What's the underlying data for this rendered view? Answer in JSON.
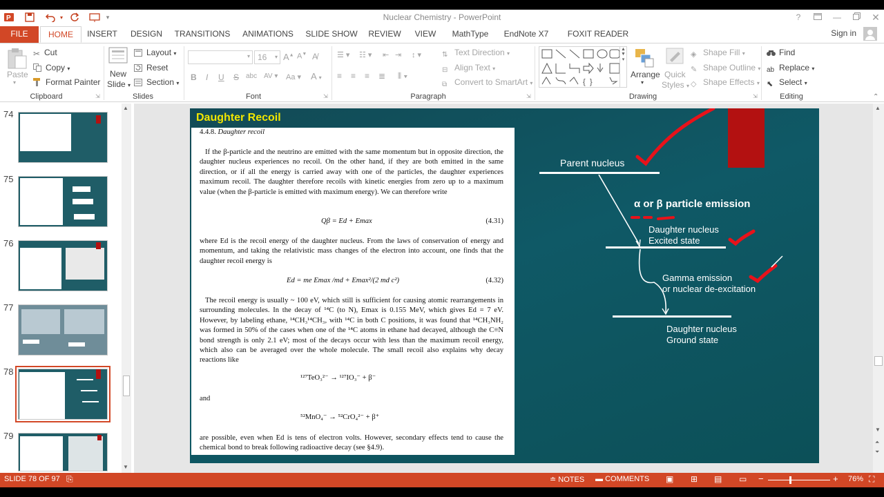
{
  "window": {
    "title": "Nuclear Chemistry - PowerPoint"
  },
  "tabs": [
    {
      "label": "FILE"
    },
    {
      "label": "HOME"
    },
    {
      "label": "INSERT"
    },
    {
      "label": "DESIGN"
    },
    {
      "label": "TRANSITIONS"
    },
    {
      "label": "ANIMATIONS"
    },
    {
      "label": "SLIDE SHOW"
    },
    {
      "label": "REVIEW"
    },
    {
      "label": "VIEW"
    },
    {
      "label": "MathType"
    },
    {
      "label": "EndNote X7"
    },
    {
      "label": "FOXIT READER PDF"
    }
  ],
  "signin": "Sign in",
  "ribbon": {
    "clipboard": {
      "paste": "Paste",
      "cut": "Cut",
      "copy": "Copy",
      "format_painter": "Format Painter",
      "label": "Clipboard"
    },
    "slides": {
      "new_slide_1": "New",
      "new_slide_2": "Slide",
      "layout": "Layout",
      "reset": "Reset",
      "section": "Section",
      "label": "Slides"
    },
    "font": {
      "size": "16",
      "label": "Font"
    },
    "paragraph": {
      "text_direction": "Text Direction",
      "align_text": "Align Text",
      "smartart": "Convert to SmartArt",
      "label": "Paragraph"
    },
    "drawing": {
      "arrange": "Arrange",
      "quick_styles_1": "Quick",
      "quick_styles_2": "Styles",
      "shape_fill": "Shape Fill",
      "shape_outline": "Shape Outline",
      "shape_effects": "Shape Effects",
      "label": "Drawing"
    },
    "editing": {
      "find": "Find",
      "replace": "Replace",
      "select": "Select",
      "label": "Editing"
    }
  },
  "thumbnails": [
    {
      "num": "74"
    },
    {
      "num": "75"
    },
    {
      "num": "76"
    },
    {
      "num": "77"
    },
    {
      "num": "78"
    },
    {
      "num": "79"
    }
  ],
  "slide": {
    "title": "Daughter Recoil",
    "doc": {
      "heading_num": "4.4.8.",
      "heading": "Daughter recoil",
      "p1": "If the β-particle and the neutrino are emitted with the same momentum but in opposite direction, the daughter nucleus experiences no recoil. On the other hand, if they are both emitted in the same direction, or if all the energy is carried away with one of the particles, the daughter experiences maximum recoil. The daughter therefore recoils with kinetic energies from zero up to a maximum value (when the β-particle is emitted with maximum energy). We can therefore write",
      "eq1": "Qβ = Ed + Emax",
      "eq1_num": "(4.31)",
      "p2": "where Ed is the recoil energy of the daughter nucleus. From the laws of conservation of energy and momentum, and taking the relativistic mass changes of the electron into account, one finds that the daughter recoil energy is",
      "eq2": "Ed = me Emax /md + Emax²/(2 md c²)",
      "eq2_num": "(4.32)",
      "p3": "The recoil energy is usually ~ 100 eV, which still is sufficient for causing atomic rearrangements in surrounding molecules. In the decay of ¹⁴C (to N), Emax is 0.155 MeV, which gives Ed = 7 eV. However, by labeling ethane, ¹⁴CH₃¹⁴CH₃, with ¹⁴C in both C positions, it was found that ¹⁴CH₃NH₂ was formed in 50% of the cases when one of the ¹⁴C atoms in ethane had decayed, although the C≡N bond strength is only 2.1 eV; most of the decays occur with less than the maximum recoil energy, which also can be averaged over the whole molecule. The small recoil also explains why decay reactions like",
      "eq3": "¹²⁷TeO₃²⁻ → ¹²⁷IO₃⁻ + β⁻",
      "and": "and",
      "eq4": "⁵²MnO₄⁻ → ⁵²CrO₄²⁻ + β⁺",
      "p4": "are possible, even when Ed is tens of electron volts. However, secondary effects tend to cause the chemical bond to break following radioactive decay (see §4.9)."
    },
    "diagram": {
      "parent": "Parent nucleus",
      "emission": "α or β particle emission",
      "excited_1": "Daughter nucleus",
      "excited_2": "Excited state",
      "gamma_1": "Gamma emission",
      "gamma_2": "or  nuclear de-excitation",
      "ground_1": "Daughter nucleus",
      "ground_2": "Ground state"
    }
  },
  "status": {
    "slide_info": "SLIDE 78 OF 97",
    "notes": "NOTES",
    "comments": "COMMENTS",
    "zoom": "76%"
  },
  "colors": {
    "accent": "#d24726",
    "slide_bg": "#0f5966",
    "title_yellow": "#f2e600",
    "annotation_red": "#e8121a"
  }
}
